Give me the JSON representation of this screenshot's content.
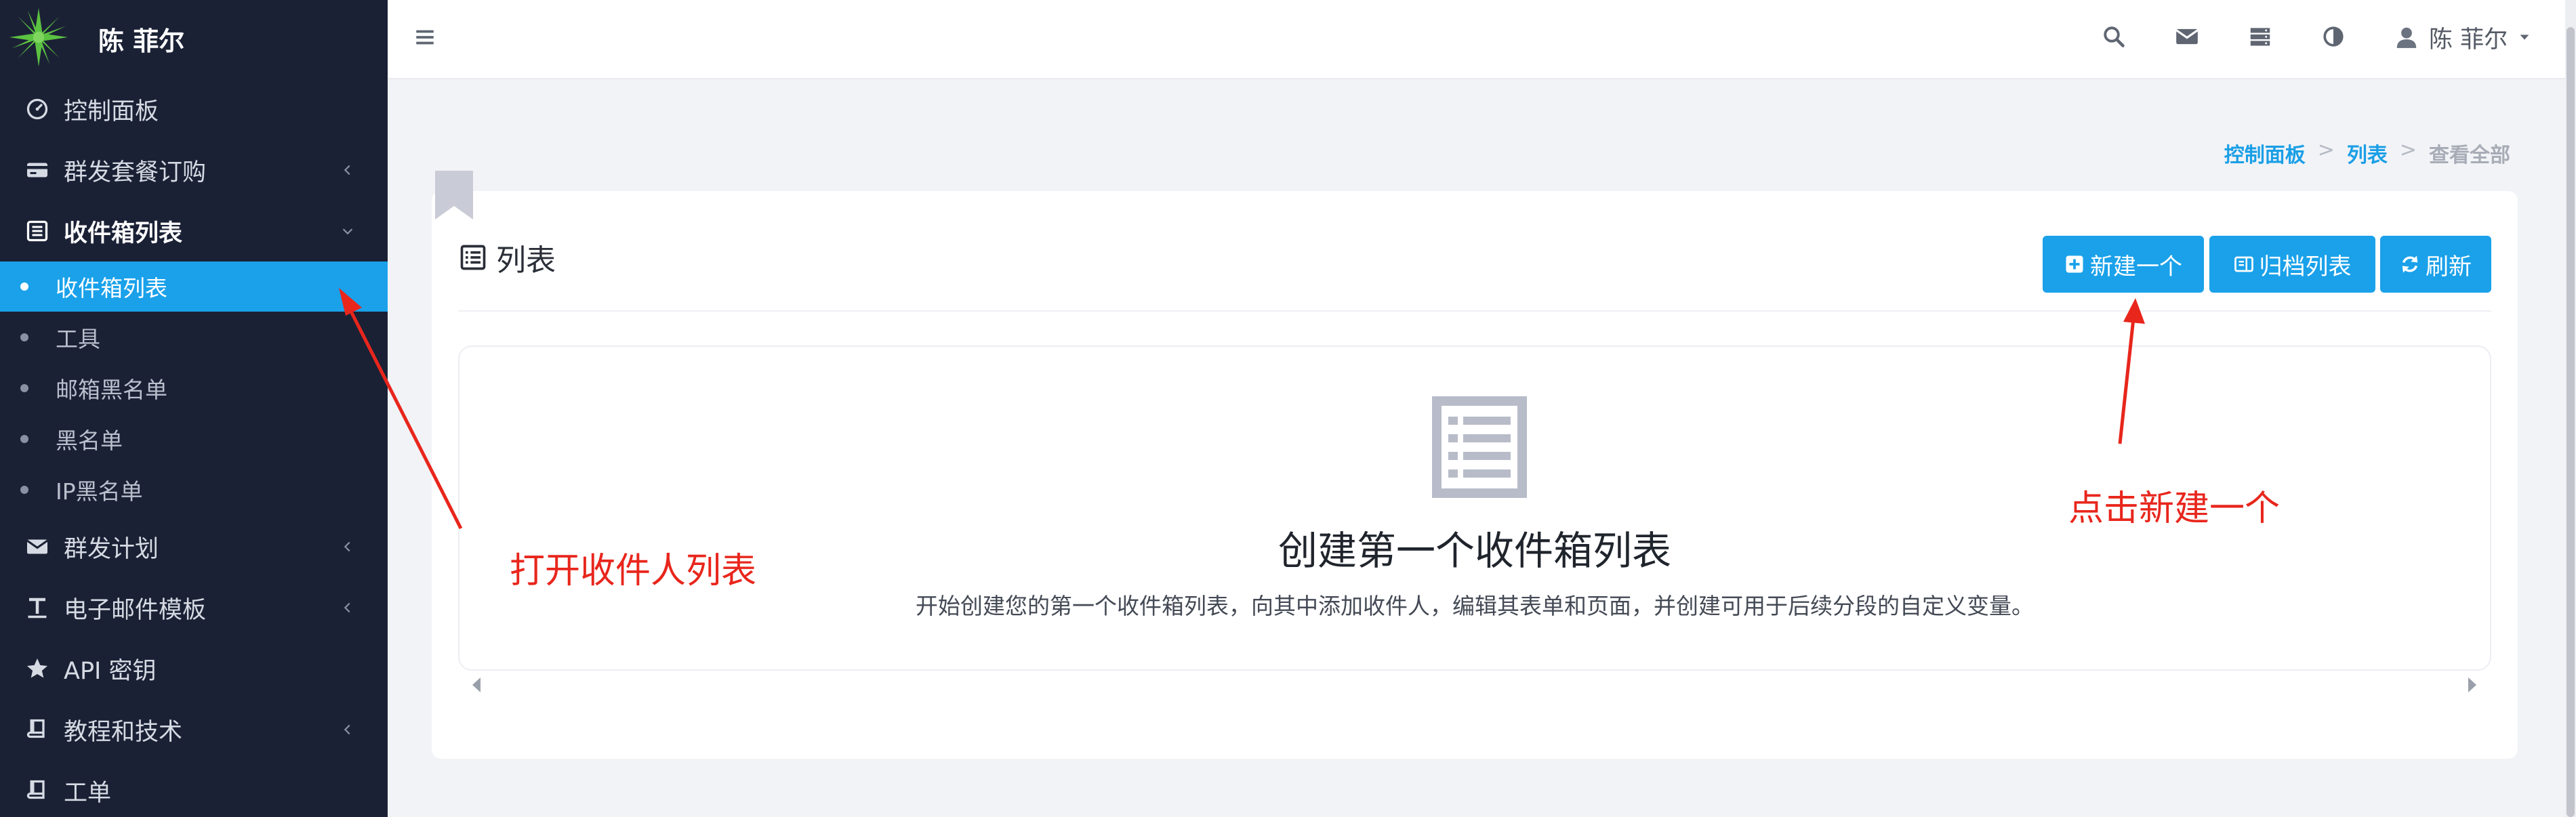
{
  "brand": {
    "name": "陈 菲尔",
    "logo_icon": "green-star-logo",
    "logo_color": "#5cc242"
  },
  "sidebar": {
    "items": [
      {
        "label": "控制面板",
        "icon": "dashboard-icon"
      },
      {
        "label": "群发套餐订购",
        "icon": "credit-card-icon"
      },
      {
        "label": "收件箱列表",
        "icon": "list-icon"
      },
      {
        "label": "群发计划",
        "icon": "envelope-icon"
      },
      {
        "label": "电子邮件模板",
        "icon": "text-format-icon"
      },
      {
        "label": "API 密钥",
        "icon": "star-icon"
      },
      {
        "label": "教程和技术",
        "icon": "book-icon"
      },
      {
        "label": "工单",
        "icon": "book-icon"
      }
    ],
    "subitems": [
      {
        "label": "收件箱列表"
      },
      {
        "label": "工具"
      },
      {
        "label": "邮箱黑名单"
      },
      {
        "label": "黑名单"
      },
      {
        "label": "IP黑名单"
      }
    ]
  },
  "header": {
    "user_name": "陈 菲尔",
    "icons": [
      "search-icon",
      "envelope-icon",
      "server-icon",
      "contrast-icon"
    ]
  },
  "breadcrumb": {
    "items": [
      "控制面板",
      "列表",
      "查看全部"
    ],
    "separator": ">"
  },
  "card": {
    "title": "列表",
    "buttons": {
      "new": "新建一个",
      "archive": "归档列表",
      "refresh": "刷新"
    },
    "empty": {
      "title": "创建第一个收件箱列表",
      "description": "开始创建您的第一个收件箱列表，向其中添加收件人，编辑其表单和页面，并创建可用于后续分段的自定义变量。"
    }
  },
  "annotations": {
    "open_list": "打开收件人列表",
    "click_new": "点击新建一个"
  },
  "colors": {
    "sidebar_bg": "#1b2135",
    "accent": "#1aa1ea",
    "annotation": "#e8261c",
    "page_bg": "#f2f3f7"
  }
}
